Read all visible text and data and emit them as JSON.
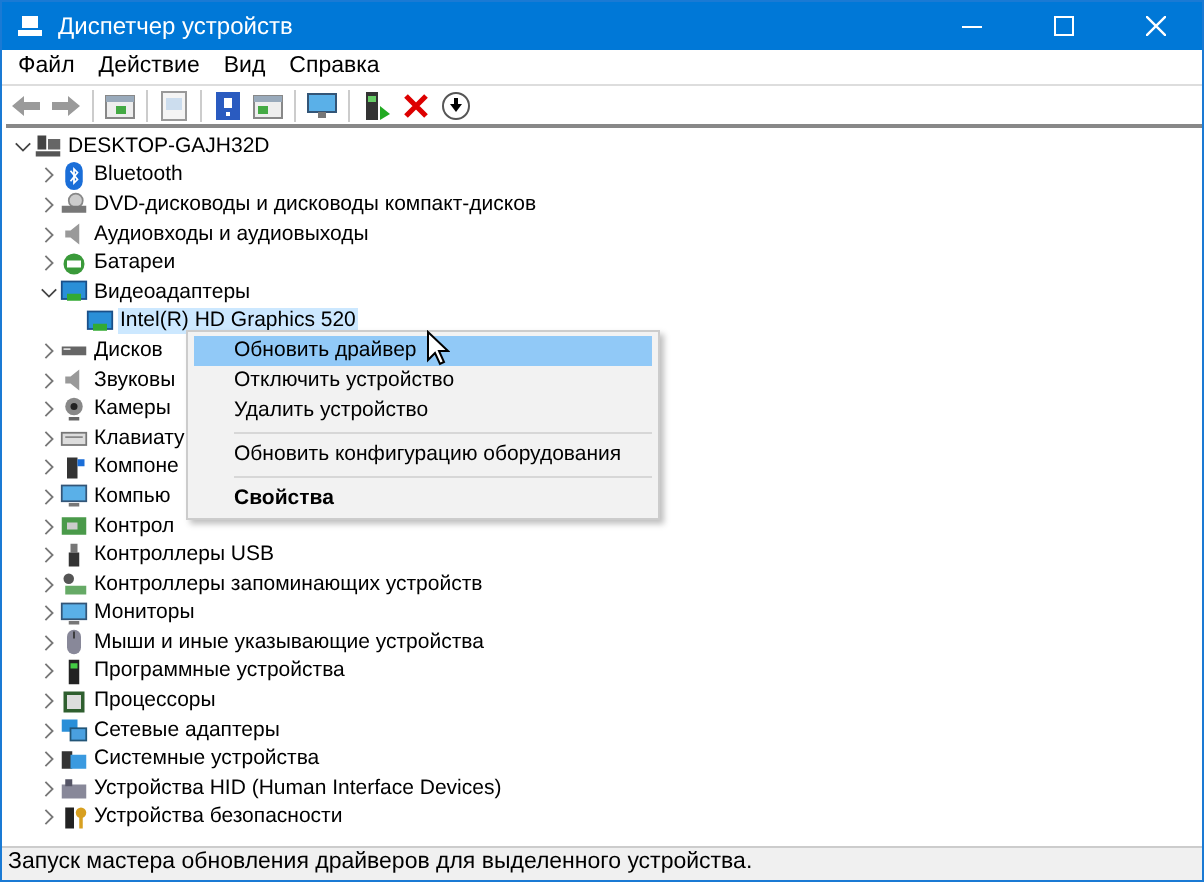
{
  "window": {
    "title": "Диспетчер устройств"
  },
  "menu": [
    "Файл",
    "Действие",
    "Вид",
    "Справка"
  ],
  "tree": [
    {
      "label": "DESKTOP-GAJH32D",
      "expanded": true,
      "selected": false,
      "children": [
        {
          "label": "Bluetooth",
          "expanded": false,
          "selected": false
        },
        {
          "label": "DVD-дисководы и дисководы компакт-дисков",
          "expanded": false,
          "selected": false
        },
        {
          "label": "Аудиовходы и аудиовыходы",
          "expanded": false,
          "selected": false
        },
        {
          "label": "Батареи",
          "expanded": false,
          "selected": false
        },
        {
          "label": "Видеоадаптеры",
          "expanded": true,
          "selected": false,
          "children": [
            {
              "label": "Intel(R) HD Graphics 520",
              "selected": true
            }
          ]
        },
        {
          "label": "Дисков",
          "expanded": false,
          "selected": false
        },
        {
          "label": "Звуковы",
          "expanded": false,
          "selected": false
        },
        {
          "label": "Камеры",
          "expanded": false,
          "selected": false
        },
        {
          "label": "Клавиату",
          "expanded": false,
          "selected": false
        },
        {
          "label": "Компоне",
          "expanded": false,
          "selected": false
        },
        {
          "label": "Компью",
          "expanded": false,
          "selected": false
        },
        {
          "label": "Контрол",
          "expanded": false,
          "selected": false
        },
        {
          "label": "Контроллеры USB",
          "expanded": false,
          "selected": false
        },
        {
          "label": "Контроллеры запоминающих устройств",
          "expanded": false,
          "selected": false
        },
        {
          "label": "Мониторы",
          "expanded": false,
          "selected": false
        },
        {
          "label": "Мыши и иные указывающие устройства",
          "expanded": false,
          "selected": false
        },
        {
          "label": "Программные устройства",
          "expanded": false,
          "selected": false
        },
        {
          "label": "Процессоры",
          "expanded": false,
          "selected": false
        },
        {
          "label": "Сетевые адаптеры",
          "expanded": false,
          "selected": false
        },
        {
          "label": "Системные устройства",
          "expanded": false,
          "selected": false
        },
        {
          "label": "Устройства HID (Human Interface Devices)",
          "expanded": false,
          "selected": false
        },
        {
          "label": "Устройства безопасности",
          "expanded": false,
          "selected": false
        }
      ]
    }
  ],
  "context_menu": [
    {
      "kind": "item",
      "label": "Обновить драйвер",
      "selected": true
    },
    {
      "kind": "item",
      "label": "Отключить устройство",
      "selected": false
    },
    {
      "kind": "item",
      "label": "Удалить устройство",
      "selected": false
    },
    {
      "kind": "separator"
    },
    {
      "kind": "item",
      "label": "Обновить конфигурацию оборудования",
      "selected": false
    },
    {
      "kind": "separator"
    },
    {
      "kind": "default",
      "label": "Свойства",
      "selected": false
    }
  ],
  "status_bar": "Запуск мастера обновления драйверов для выделенного устройства."
}
